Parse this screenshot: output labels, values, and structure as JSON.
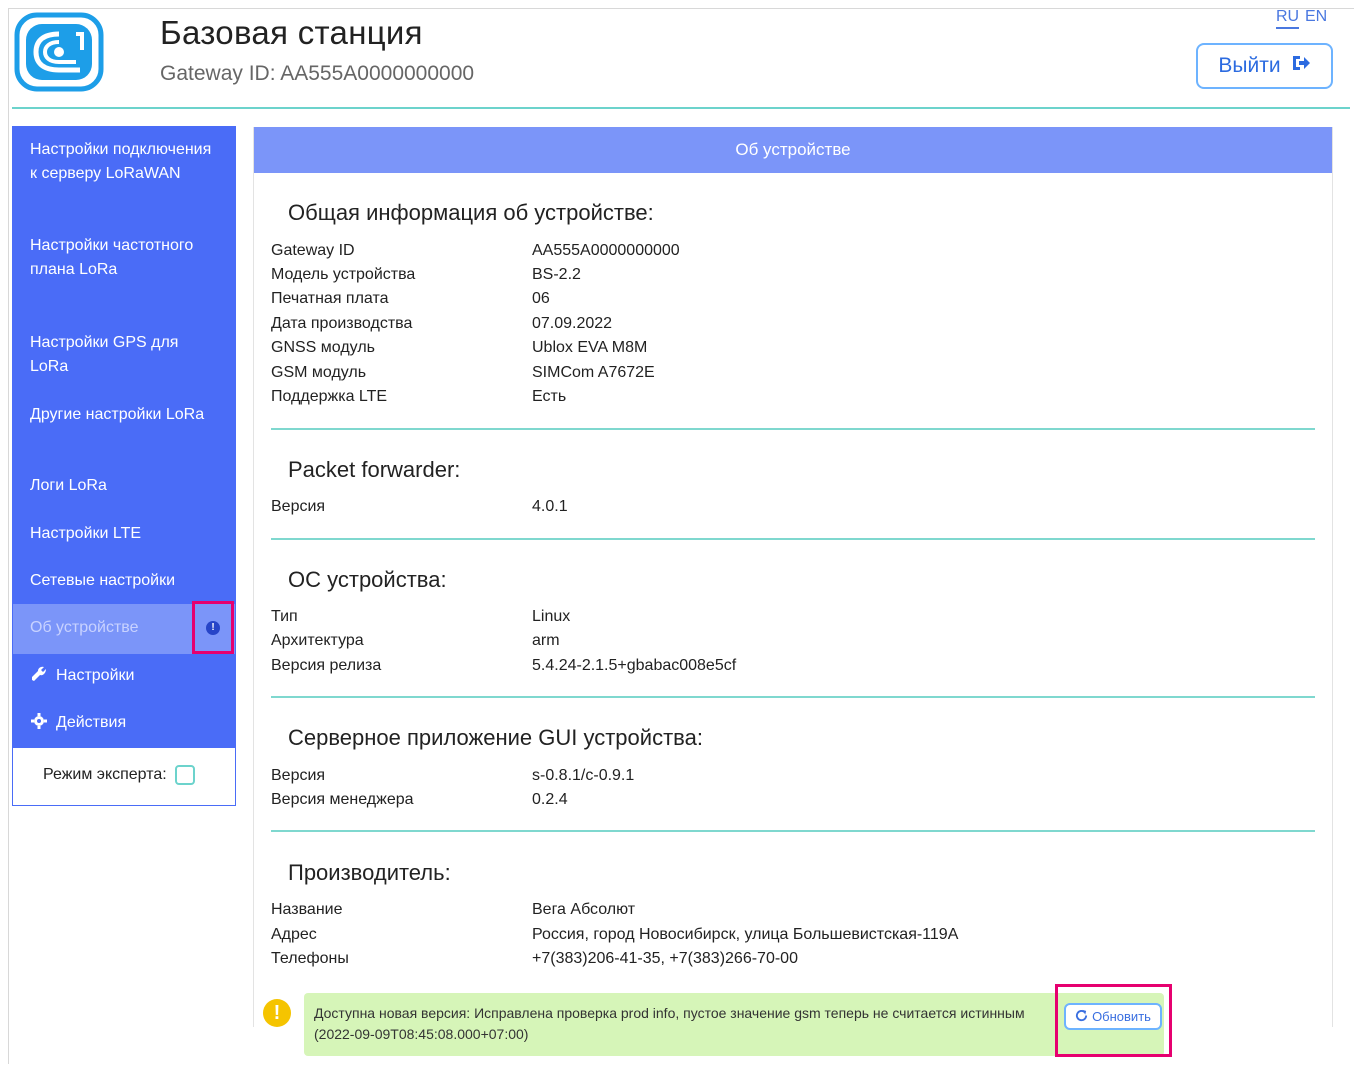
{
  "header": {
    "title": "Базовая станция",
    "subtitle": "Gateway ID: AA555A0000000000",
    "lang_ru": "RU",
    "lang_en": "EN",
    "logout_label": "Выйти"
  },
  "sidebar": {
    "items": [
      {
        "label": "Настройки подключения к серверу LoRaWAN"
      },
      {
        "label": "Настройки частотного плана LoRa"
      },
      {
        "label": "Настройки GPS для LoRa"
      },
      {
        "label": "Другие настройки LoRa"
      },
      {
        "label": "Логи LoRa"
      },
      {
        "label": "Настройки LTE"
      },
      {
        "label": "Сетевые настройки"
      },
      {
        "label": "Об устройстве"
      },
      {
        "label": "Настройки"
      },
      {
        "label": "Действия"
      }
    ],
    "expert_mode_label": "Режим эксперта:"
  },
  "main": {
    "header": "Об устройстве",
    "sections": [
      {
        "title": "Общая информация об устройстве:",
        "rows": [
          {
            "key": "Gateway ID",
            "value": "AA555A0000000000"
          },
          {
            "key": "Модель устройства",
            "value": "BS-2.2"
          },
          {
            "key": "Печатная плата",
            "value": "06"
          },
          {
            "key": "Дата производства",
            "value": "07.09.2022"
          },
          {
            "key": "GNSS модуль",
            "value": "Ublox EVA M8M"
          },
          {
            "key": "GSM модуль",
            "value": "SIMCom A7672E"
          },
          {
            "key": "Поддержка LTE",
            "value": "Есть"
          }
        ]
      },
      {
        "title": "Packet forwarder:",
        "rows": [
          {
            "key": "Версия",
            "value": "4.0.1"
          }
        ]
      },
      {
        "title": "ОС устройства:",
        "rows": [
          {
            "key": "Тип",
            "value": "Linux"
          },
          {
            "key": "Архитектура",
            "value": "arm"
          },
          {
            "key": "Версия релиза",
            "value": "5.4.24-2.1.5+gbabac008e5cf"
          }
        ]
      },
      {
        "title": "Серверное приложение GUI устройства:",
        "rows": [
          {
            "key": "Версия",
            "value": "s-0.8.1/c-0.9.1"
          },
          {
            "key": "Версия менеджера",
            "value": "0.2.4"
          }
        ]
      },
      {
        "title": "Производитель:",
        "rows": [
          {
            "key": "Название",
            "value": "Вега Абсолют"
          },
          {
            "key": "Адрес",
            "value": "Россия, город Новосибирск, улица Большевистская-119А"
          },
          {
            "key": "Телефоны",
            "value": "+7(383)206-41-35, +7(383)266-70-00"
          }
        ]
      }
    ]
  },
  "notification": {
    "text": "Доступна новая версия: Исправлена проверка prod info, пустое значение gsm теперь не считается истинным (2022-09-09T08:45:08.000+07:00)",
    "update_label": "Обновить"
  },
  "colors": {
    "sidebar_bg": "#4a6cf7",
    "active_bg": "#7b95f9",
    "accent_teal": "#6cd3cc",
    "highlight": "#e6006f",
    "notice_bg": "#d6f5b8"
  }
}
